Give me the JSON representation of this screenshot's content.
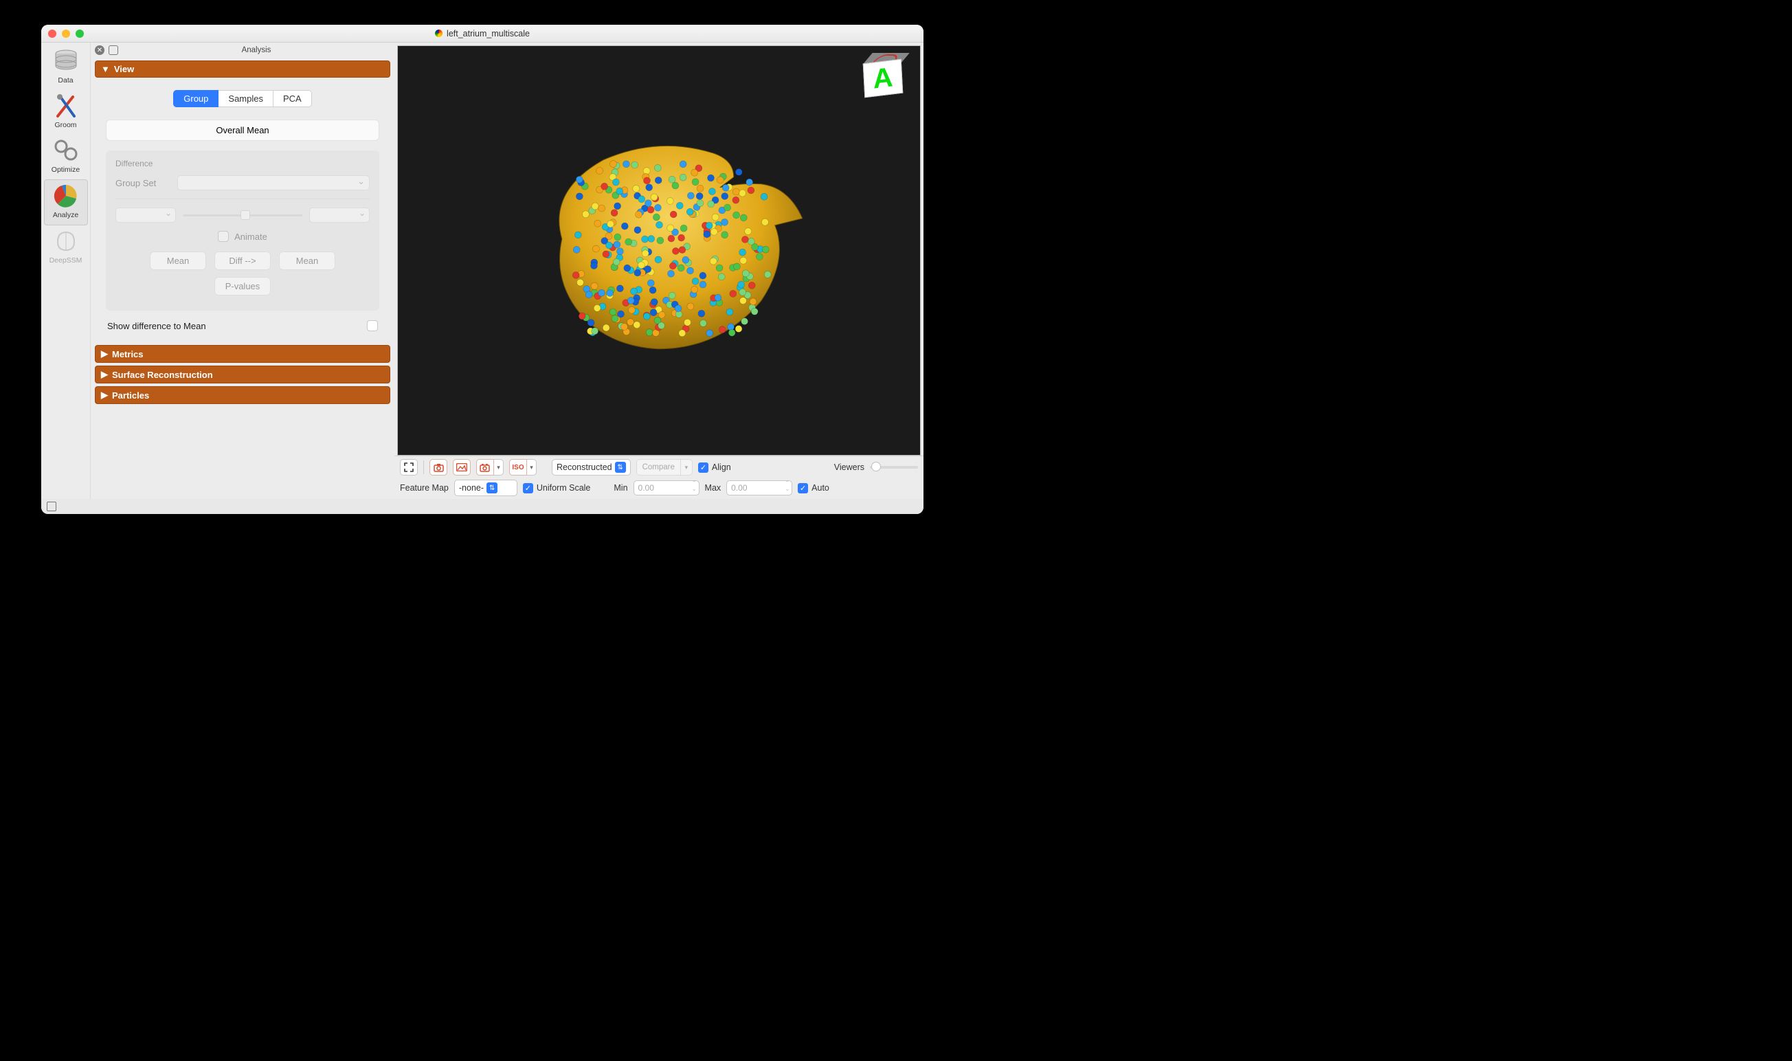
{
  "window": {
    "title": "left_atrium_multiscale"
  },
  "sidebar": {
    "items": [
      {
        "label": "Data"
      },
      {
        "label": "Groom"
      },
      {
        "label": "Optimize"
      },
      {
        "label": "Analyze"
      },
      {
        "label": "DeepSSM"
      }
    ]
  },
  "panel": {
    "title": "Analysis",
    "sections": {
      "view": "View",
      "metrics": "Metrics",
      "surface": "Surface Reconstruction",
      "particles": "Particles"
    },
    "segmented": {
      "group": "Group",
      "samples": "Samples",
      "pca": "PCA"
    },
    "overall_mean": "Overall Mean",
    "difference": {
      "title": "Difference",
      "group_set": "Group Set",
      "animate": "Animate",
      "mean_left": "Mean",
      "diff": "Diff -->",
      "mean_right": "Mean",
      "pvalues": "P-values"
    },
    "show_diff": "Show difference to Mean"
  },
  "toolbar": {
    "display_mode": "Reconstructed",
    "compare": "Compare",
    "align": "Align",
    "viewers": "Viewers"
  },
  "feature_bar": {
    "label": "Feature Map",
    "selected": "-none-",
    "uniform_scale": "Uniform Scale",
    "min_label": "Min",
    "min_value": "0.00",
    "max_label": "Max",
    "max_value": "0.00",
    "auto": "Auto"
  },
  "orientation_cube": {
    "face": "A"
  }
}
